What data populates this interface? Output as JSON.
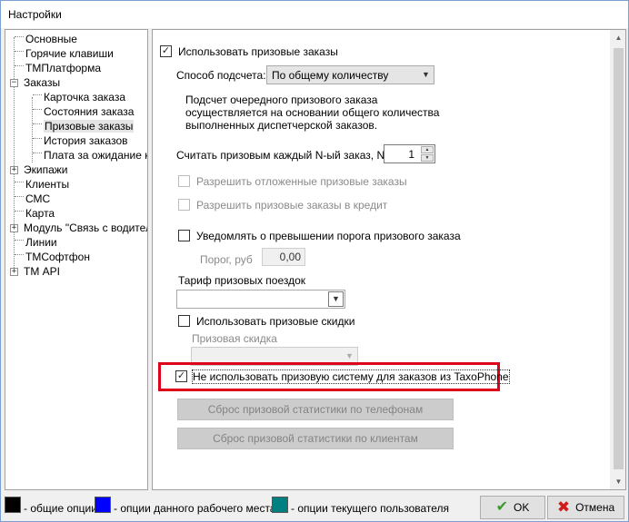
{
  "window": {
    "title": "Настройки"
  },
  "tree": {
    "items": [
      {
        "label": "Основные"
      },
      {
        "label": "Горячие клавиши"
      },
      {
        "label": "ТМПлатформа"
      },
      {
        "label": "Заказы",
        "expander": "⊟"
      },
      {
        "label": "Карточка заказа"
      },
      {
        "label": "Состояния заказа"
      },
      {
        "label": "Призовые заказы"
      },
      {
        "label": "История заказов"
      },
      {
        "label": "Плата за ожидание кл"
      },
      {
        "label": "Экипажи",
        "expander": "⊞"
      },
      {
        "label": "Клиенты"
      },
      {
        "label": "СМС"
      },
      {
        "label": "Карта"
      },
      {
        "label": "Модуль \"Связь с водителе",
        "expander": "⊞"
      },
      {
        "label": "Линии"
      },
      {
        "label": "ТМСофтфон"
      },
      {
        "label": "ТМ API",
        "expander": "⊞"
      }
    ]
  },
  "settings": {
    "use_prize_orders": {
      "label": "Использовать призовые заказы",
      "checked": true
    },
    "count_method": {
      "label": "Способ подсчета:",
      "value": "По общему количеству"
    },
    "description": {
      "line1": "Подсчет очередного призового заказа",
      "line2": "осуществляется на основании общего количества",
      "line3": "выполненных диспетчерской заказов."
    },
    "nth_order": {
      "label": "Считать призовым каждый N-ый заказ, N =:",
      "value": "1"
    },
    "allow_deferred": {
      "label": "Разрешить отложенные призовые заказы",
      "checked": false
    },
    "allow_credit": {
      "label": "Разрешить призовые заказы в кредит",
      "checked": false
    },
    "notify_threshold": {
      "label": "Уведомлять о превышении порога призового заказа",
      "checked": false
    },
    "threshold": {
      "label": "Порог, руб",
      "value": "0,00"
    },
    "tariff": {
      "label": "Тариф призовых поездок",
      "value": ""
    },
    "use_discounts": {
      "label": "Использовать призовые скидки",
      "checked": false
    },
    "discount": {
      "label": "Призовая скидка",
      "value": ""
    },
    "no_taxophone": {
      "label": "Не использовать призовую систему для заказов из TaxoPhone",
      "checked": true
    },
    "reset_phone_label": "Сброс призовой статистики по телефонам",
    "reset_clients_label": "Сброс призовой статистики по клиентам"
  },
  "legend": {
    "common": {
      "label": "- общие опции",
      "color": "#000000"
    },
    "workstation": {
      "label": "- опции данного рабочего места",
      "color": "#0000ff"
    },
    "user": {
      "label": "- опции текущего пользователя",
      "color": "#008080"
    }
  },
  "buttons": {
    "ok": "OK",
    "cancel": "Отмена"
  },
  "colors": {
    "highlight": "#e0001a"
  }
}
